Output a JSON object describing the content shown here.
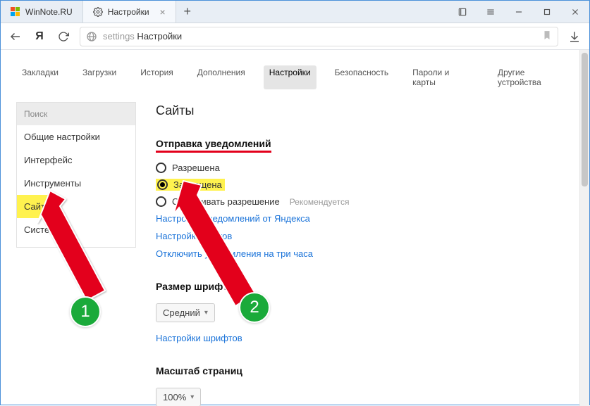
{
  "window": {
    "tabs": [
      {
        "label": "WinNote.RU"
      },
      {
        "label": "Настройки"
      }
    ]
  },
  "toolbar": {
    "address_prefix": "settings",
    "address_rest": " Настройки"
  },
  "topnav": {
    "items": [
      "Закладки",
      "Загрузки",
      "История",
      "Дополнения",
      "Настройки",
      "Безопасность",
      "Пароли и карты",
      "Другие устройства"
    ],
    "active_index": 4
  },
  "sidebar": {
    "search_placeholder": "Поиск",
    "items": [
      "Общие настройки",
      "Интерфейс",
      "Инструменты",
      "Сайты",
      "Системные"
    ],
    "highlight_index": 3
  },
  "main": {
    "title": "Сайты",
    "notifications": {
      "heading": "Отправка уведомлений",
      "options": [
        {
          "label": "Разрешена",
          "selected": false
        },
        {
          "label": "Запрещена",
          "selected": true,
          "highlight": true
        },
        {
          "label": "Спрашивать разрешение",
          "selected": false,
          "hint": "Рекомендуется"
        }
      ],
      "links": [
        "Настройки уведомлений от Яндекса",
        "Настройки сайтов",
        "Отключить уведомления на три часа"
      ]
    },
    "font": {
      "heading": "Размер шрифта",
      "value": "Средний",
      "link": "Настройки шрифтов"
    },
    "zoom": {
      "heading": "Масштаб страниц",
      "value": "100%"
    }
  },
  "annotations": {
    "badge1": "1",
    "badge2": "2"
  }
}
